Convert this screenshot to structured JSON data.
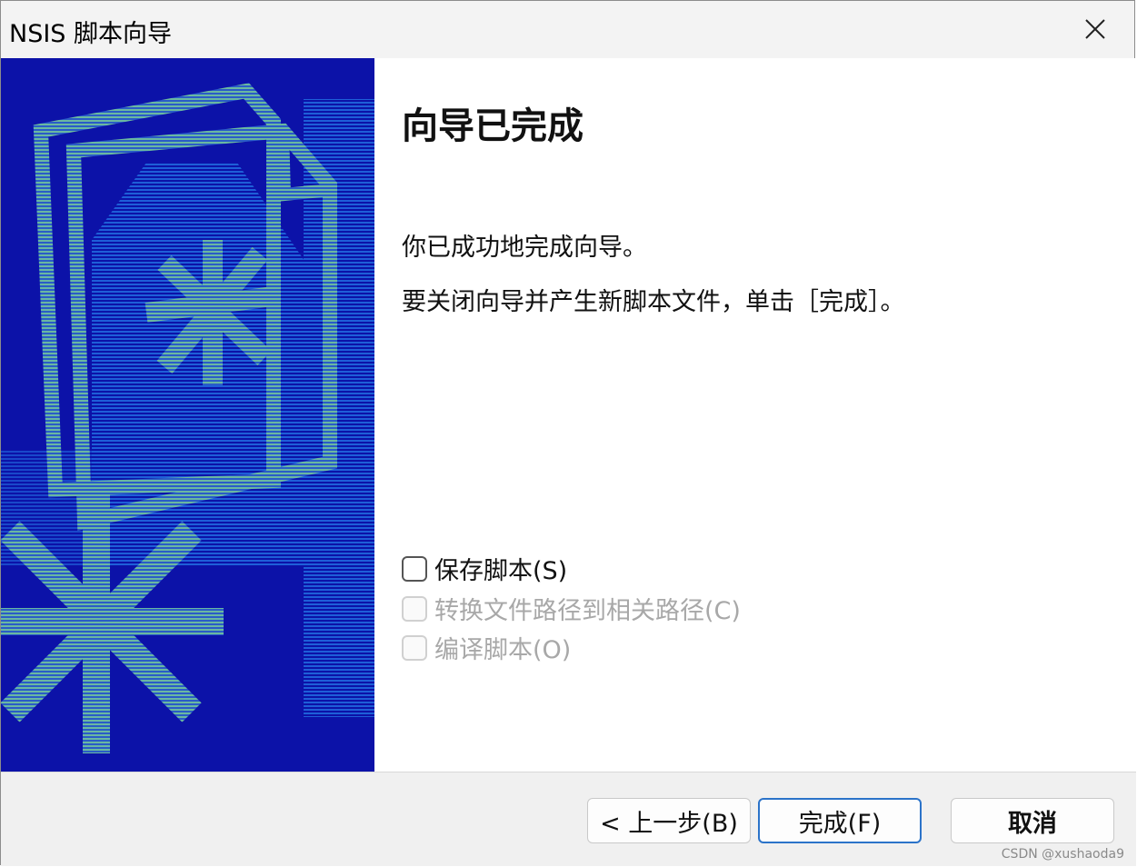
{
  "window": {
    "title": "NSIS 脚本向导",
    "close_icon": "close-icon"
  },
  "side_panel": {
    "image": "nsis-wizard-banner",
    "colors": {
      "background": "#0c12a8",
      "accent": "#1e5fd8",
      "art": "#6ab8a0"
    }
  },
  "main": {
    "heading": "向导已完成",
    "message_1": "你已成功地完成向导。",
    "message_2": "要关闭向导并产生新脚本文件，单击［完成］。",
    "options": [
      {
        "label": "保存脚本(S)",
        "checked": false,
        "enabled": true
      },
      {
        "label": "转换文件路径到相关路径(C)",
        "checked": false,
        "enabled": false
      },
      {
        "label": "编译脚本(O)",
        "checked": false,
        "enabled": false
      }
    ]
  },
  "footer": {
    "back_label": "< 上一步(B)",
    "finish_label": "完成(F)",
    "cancel_label": "取消",
    "primary_color": "#2b73c9"
  },
  "watermark": "CSDN @xushaoda9"
}
